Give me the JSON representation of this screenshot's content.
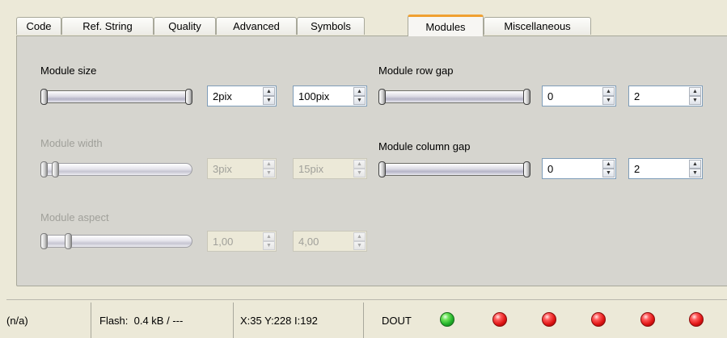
{
  "tabs": [
    {
      "label": "Code"
    },
    {
      "label": "Ref. String"
    },
    {
      "label": "Quality"
    },
    {
      "label": "Advanced"
    },
    {
      "label": "Symbols"
    },
    {
      "label": "Modules"
    },
    {
      "label": "Miscellaneous"
    }
  ],
  "active_tab": "Modules",
  "modules": {
    "module_size": {
      "label": "Module size",
      "min": "2pix",
      "max": "100pix",
      "enabled": true
    },
    "module_width": {
      "label": "Module width",
      "min": "3pix",
      "max": "15pix",
      "enabled": false
    },
    "module_aspect": {
      "label": "Module aspect",
      "min": "1,00",
      "max": "4,00",
      "enabled": false
    },
    "module_row_gap": {
      "label": "Module row gap",
      "min": "0",
      "max": "2",
      "enabled": true
    },
    "module_column_gap": {
      "label": "Module column gap",
      "min": "0",
      "max": "2",
      "enabled": true
    }
  },
  "status_bar": {
    "selection": "(n/a)",
    "flash": "Flash:  0.4 kB / ---",
    "coords": "X:35 Y:228 I:192",
    "dout_label": "DOUT",
    "leds": [
      "green",
      "red",
      "red",
      "red",
      "red",
      "red"
    ]
  },
  "colors": {
    "led_on": "#22b12a",
    "led_off": "#e01616",
    "active_tab_accent": "#f0a030"
  }
}
